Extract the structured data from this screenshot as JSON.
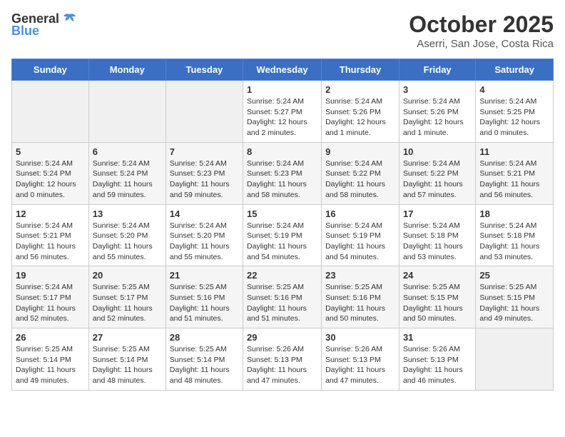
{
  "header": {
    "logo_general": "General",
    "logo_blue": "Blue",
    "month_title": "October 2025",
    "location": "Aserri, San Jose, Costa Rica"
  },
  "weekdays": [
    "Sunday",
    "Monday",
    "Tuesday",
    "Wednesday",
    "Thursday",
    "Friday",
    "Saturday"
  ],
  "weeks": [
    [
      {
        "day": "",
        "info": ""
      },
      {
        "day": "",
        "info": ""
      },
      {
        "day": "",
        "info": ""
      },
      {
        "day": "1",
        "info": "Sunrise: 5:24 AM\nSunset: 5:27 PM\nDaylight: 12 hours\nand 2 minutes."
      },
      {
        "day": "2",
        "info": "Sunrise: 5:24 AM\nSunset: 5:26 PM\nDaylight: 12 hours\nand 1 minute."
      },
      {
        "day": "3",
        "info": "Sunrise: 5:24 AM\nSunset: 5:26 PM\nDaylight: 12 hours\nand 1 minute."
      },
      {
        "day": "4",
        "info": "Sunrise: 5:24 AM\nSunset: 5:25 PM\nDaylight: 12 hours\nand 0 minutes."
      }
    ],
    [
      {
        "day": "5",
        "info": "Sunrise: 5:24 AM\nSunset: 5:24 PM\nDaylight: 12 hours\nand 0 minutes."
      },
      {
        "day": "6",
        "info": "Sunrise: 5:24 AM\nSunset: 5:24 PM\nDaylight: 11 hours\nand 59 minutes."
      },
      {
        "day": "7",
        "info": "Sunrise: 5:24 AM\nSunset: 5:23 PM\nDaylight: 11 hours\nand 59 minutes."
      },
      {
        "day": "8",
        "info": "Sunrise: 5:24 AM\nSunset: 5:23 PM\nDaylight: 11 hours\nand 58 minutes."
      },
      {
        "day": "9",
        "info": "Sunrise: 5:24 AM\nSunset: 5:22 PM\nDaylight: 11 hours\nand 58 minutes."
      },
      {
        "day": "10",
        "info": "Sunrise: 5:24 AM\nSunset: 5:22 PM\nDaylight: 11 hours\nand 57 minutes."
      },
      {
        "day": "11",
        "info": "Sunrise: 5:24 AM\nSunset: 5:21 PM\nDaylight: 11 hours\nand 56 minutes."
      }
    ],
    [
      {
        "day": "12",
        "info": "Sunrise: 5:24 AM\nSunset: 5:21 PM\nDaylight: 11 hours\nand 56 minutes."
      },
      {
        "day": "13",
        "info": "Sunrise: 5:24 AM\nSunset: 5:20 PM\nDaylight: 11 hours\nand 55 minutes."
      },
      {
        "day": "14",
        "info": "Sunrise: 5:24 AM\nSunset: 5:20 PM\nDaylight: 11 hours\nand 55 minutes."
      },
      {
        "day": "15",
        "info": "Sunrise: 5:24 AM\nSunset: 5:19 PM\nDaylight: 11 hours\nand 54 minutes."
      },
      {
        "day": "16",
        "info": "Sunrise: 5:24 AM\nSunset: 5:19 PM\nDaylight: 11 hours\nand 54 minutes."
      },
      {
        "day": "17",
        "info": "Sunrise: 5:24 AM\nSunset: 5:18 PM\nDaylight: 11 hours\nand 53 minutes."
      },
      {
        "day": "18",
        "info": "Sunrise: 5:24 AM\nSunset: 5:18 PM\nDaylight: 11 hours\nand 53 minutes."
      }
    ],
    [
      {
        "day": "19",
        "info": "Sunrise: 5:24 AM\nSunset: 5:17 PM\nDaylight: 11 hours\nand 52 minutes."
      },
      {
        "day": "20",
        "info": "Sunrise: 5:25 AM\nSunset: 5:17 PM\nDaylight: 11 hours\nand 52 minutes."
      },
      {
        "day": "21",
        "info": "Sunrise: 5:25 AM\nSunset: 5:16 PM\nDaylight: 11 hours\nand 51 minutes."
      },
      {
        "day": "22",
        "info": "Sunrise: 5:25 AM\nSunset: 5:16 PM\nDaylight: 11 hours\nand 51 minutes."
      },
      {
        "day": "23",
        "info": "Sunrise: 5:25 AM\nSunset: 5:16 PM\nDaylight: 11 hours\nand 50 minutes."
      },
      {
        "day": "24",
        "info": "Sunrise: 5:25 AM\nSunset: 5:15 PM\nDaylight: 11 hours\nand 50 minutes."
      },
      {
        "day": "25",
        "info": "Sunrise: 5:25 AM\nSunset: 5:15 PM\nDaylight: 11 hours\nand 49 minutes."
      }
    ],
    [
      {
        "day": "26",
        "info": "Sunrise: 5:25 AM\nSunset: 5:14 PM\nDaylight: 11 hours\nand 49 minutes."
      },
      {
        "day": "27",
        "info": "Sunrise: 5:25 AM\nSunset: 5:14 PM\nDaylight: 11 hours\nand 48 minutes."
      },
      {
        "day": "28",
        "info": "Sunrise: 5:25 AM\nSunset: 5:14 PM\nDaylight: 11 hours\nand 48 minutes."
      },
      {
        "day": "29",
        "info": "Sunrise: 5:26 AM\nSunset: 5:13 PM\nDaylight: 11 hours\nand 47 minutes."
      },
      {
        "day": "30",
        "info": "Sunrise: 5:26 AM\nSunset: 5:13 PM\nDaylight: 11 hours\nand 47 minutes."
      },
      {
        "day": "31",
        "info": "Sunrise: 5:26 AM\nSunset: 5:13 PM\nDaylight: 11 hours\nand 46 minutes."
      },
      {
        "day": "",
        "info": ""
      }
    ]
  ]
}
